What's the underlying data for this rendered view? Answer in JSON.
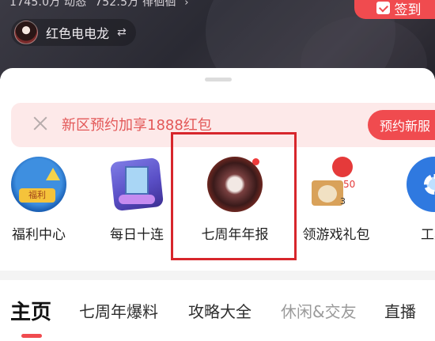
{
  "header": {
    "stats_dynamic": "1745.0万 动态",
    "stats_fans": "752.5万 徘徊徊",
    "stats_arrow": "›",
    "username": "红色电电龙",
    "switch_icon": "⇄",
    "checkin_label": "签到"
  },
  "banner": {
    "text": "新区预约加享1888红包",
    "button": "预约新服"
  },
  "shortcuts": [
    {
      "label": "福利中心",
      "icon": "welfare-center-icon",
      "badge": "福利"
    },
    {
      "label": "每日十连",
      "icon": "daily-ten-pull-icon"
    },
    {
      "label": "七周年年报",
      "icon": "seventh-anniversary-report-icon"
    },
    {
      "label": "领游戏礼包",
      "icon": "game-gift-pack-icon",
      "n1": "50",
      "n2": "3"
    },
    {
      "label": "工具",
      "icon": "tools-icon"
    }
  ],
  "tabs": [
    {
      "label": "主页",
      "active": true
    },
    {
      "label": "七周年爆料"
    },
    {
      "label": "攻略大全"
    },
    {
      "label": "休闲&交友"
    },
    {
      "label": "直播"
    }
  ],
  "colors": {
    "accent": "#f04b4f",
    "highlight_frame": "#d7262c",
    "banner_bg": "#fde9e9",
    "banner_text": "#e35858"
  }
}
